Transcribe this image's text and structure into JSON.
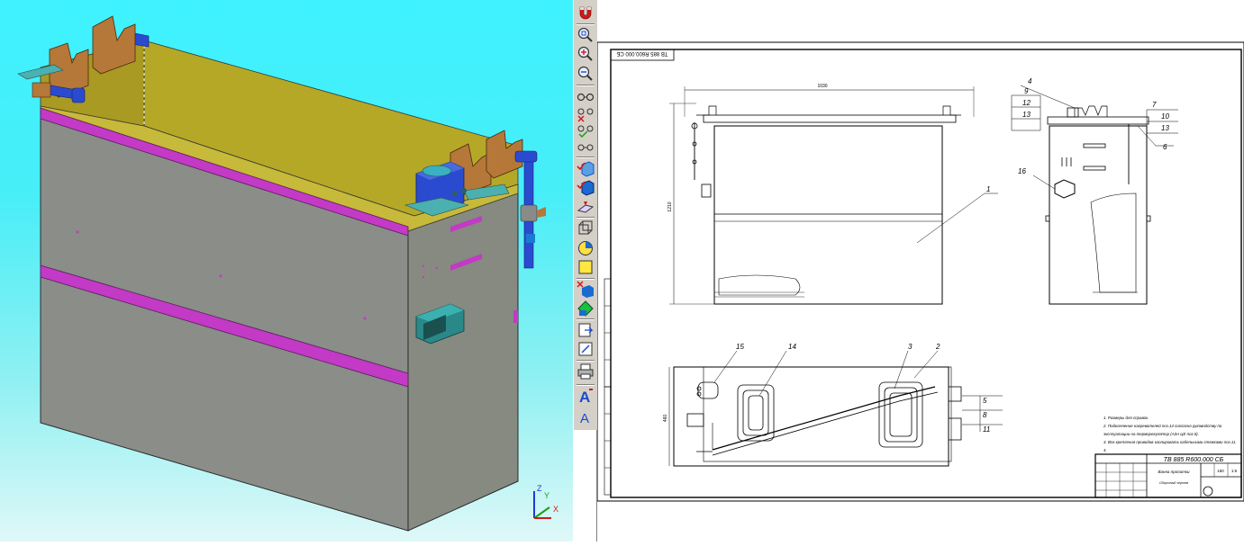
{
  "model_view": {
    "axis_labels": {
      "z": "Z",
      "y": "Y",
      "x": "X"
    }
  },
  "toolbar": {
    "buttons": [
      {
        "name": "magnet-icon"
      },
      {
        "name": "zoom-window-icon"
      },
      {
        "name": "zoom-in-icon"
      },
      {
        "name": "zoom-out-icon"
      },
      {
        "name": "glasses-icon"
      },
      {
        "name": "glasses-cross-icon"
      },
      {
        "name": "glasses-check-icon"
      },
      {
        "name": "glasses-show-icon"
      },
      {
        "name": "check-cube-icon"
      },
      {
        "name": "check-cube-blue-icon"
      },
      {
        "name": "plane-icon"
      },
      {
        "name": "cube-wireframe-icon"
      },
      {
        "name": "sphere-section-icon"
      },
      {
        "name": "square-yellow-icon"
      },
      {
        "name": "cross-cube-icon"
      },
      {
        "name": "green-diamond-icon"
      },
      {
        "name": "arrow-box-icon"
      },
      {
        "name": "edit-box-icon"
      },
      {
        "name": "printer-icon"
      },
      {
        "name": "text-a-red-icon"
      },
      {
        "name": "text-a-blue-icon"
      }
    ]
  },
  "drawing": {
    "sheet_code_rotated": "ТВ 885 R600.000 СБ",
    "front_view": {
      "width_dim": "1030",
      "height_dim": "1210",
      "callout_1": "1"
    },
    "side_view": {
      "callouts_left": [
        "4",
        "9",
        "12",
        "13"
      ],
      "callouts_right": [
        "7",
        "10",
        "13",
        "6"
      ],
      "callout_16": "16"
    },
    "top_view": {
      "callouts_top": [
        "15",
        "14",
        "3",
        "2"
      ],
      "callouts_right": [
        "5",
        "8",
        "11"
      ],
      "height_dim": "460"
    },
    "notes": [
      "1. Размеры для справок.",
      "2. Подключение нагревателей поз.14 согласно руководству по",
      "эксплуатации на терморегулятор (АЗА ЦЕ поз.5).",
      "3. Все крепления проводов изолировать кабельными стяжками поз.11.",
      "4."
    ],
    "title_block": {
      "code": "ТВ 885 R600.000 СБ",
      "name": "Ванна пропитки",
      "subtitle": "Сборочный чертеж",
      "scale": "1:5",
      "mass": "160"
    }
  }
}
